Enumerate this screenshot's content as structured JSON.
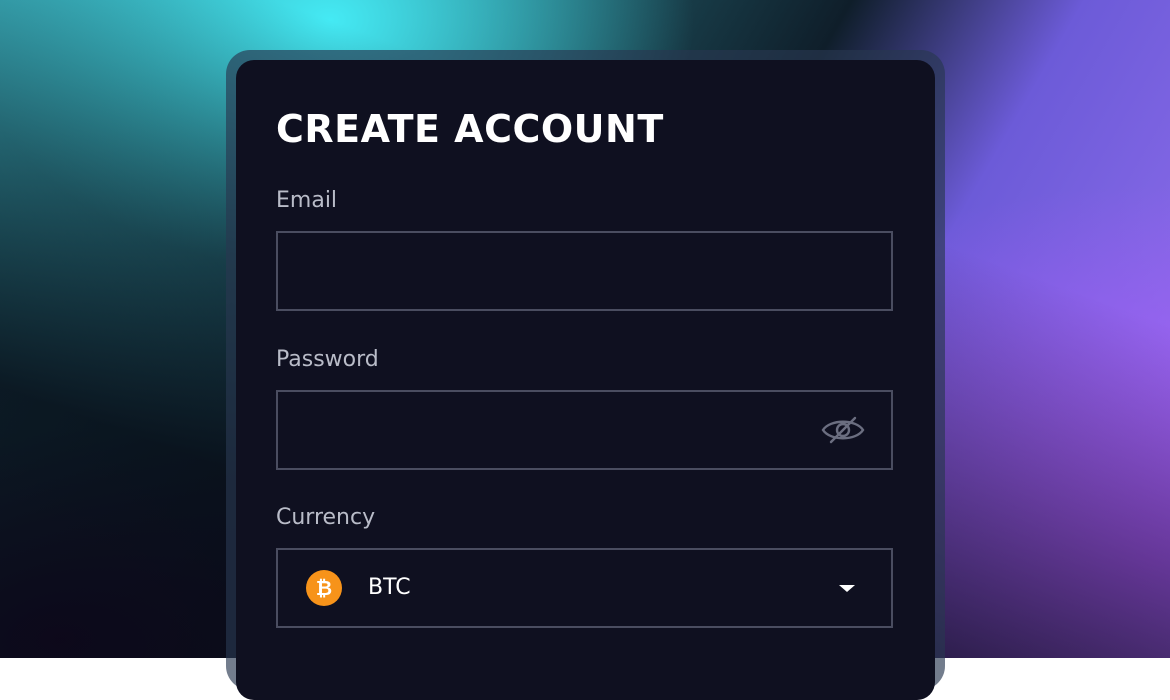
{
  "form": {
    "title": "CREATE ACCOUNT",
    "email": {
      "label": "Email",
      "value": "",
      "placeholder": ""
    },
    "password": {
      "label": "Password",
      "value": "",
      "placeholder": "",
      "toggle_icon": "eye-off-icon"
    },
    "currency": {
      "label": "Currency",
      "selected": "BTC",
      "icon": "bitcoin-icon",
      "icon_glyph": "₿",
      "icon_color": "#f7931a"
    }
  },
  "colors": {
    "card_background": "#0f1020",
    "field_border": "#4a4d60",
    "label_text": "#b9bcc8",
    "title_text": "#ffffff"
  }
}
